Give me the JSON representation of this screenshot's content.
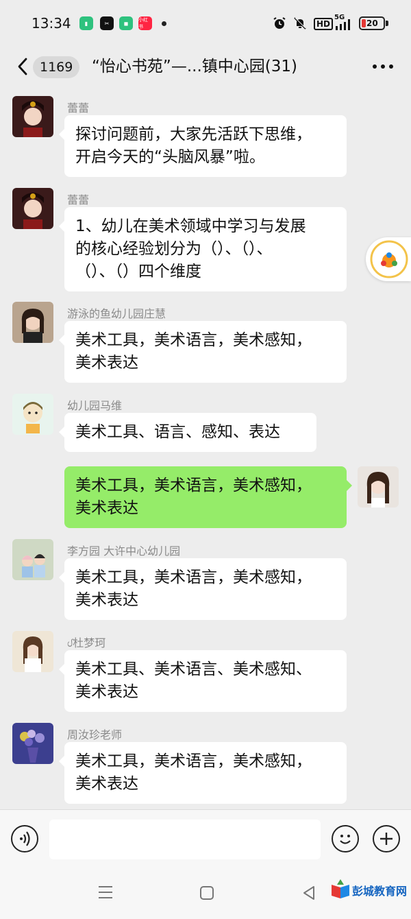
{
  "status_bar": {
    "time": "13:34",
    "app_icons": [
      "battery-app-icon",
      "capcut-icon",
      "wechat-icon",
      "xiaohongshu-icon"
    ],
    "xiaohongshu_label": "小红书",
    "network": "5G",
    "hd_label": "HD",
    "battery_level": "20",
    "icons": [
      "alarm-icon",
      "mute-icon",
      "hd-icon",
      "signal-icon",
      "battery-icon"
    ]
  },
  "header": {
    "unread_count": "1169",
    "title": "“怡心书苑”—...镇中心园(31)"
  },
  "messages": [
    {
      "sender": "蕾蕾",
      "lines": [
        "探讨问题前，大家先活跃下思维，",
        "开启今天的“头脑风暴”啦。"
      ],
      "mine": false
    },
    {
      "sender": "蕾蕾",
      "lines": [
        "1、幼儿在美术领域中学习与发展",
        "的核心经验划分为（）、（）、",
        "（）、（）四个维度"
      ],
      "mine": false
    },
    {
      "sender": "游泳的鱼幼儿园庄慧",
      "lines": [
        "美术工具，美术语言，美术感知，",
        "美术表达"
      ],
      "mine": false
    },
    {
      "sender": "幼儿园马维",
      "lines": [
        "美术工具、语言、感知、表达"
      ],
      "mine": false
    },
    {
      "sender": "",
      "lines": [
        "美术工具，美术语言，美术感知，",
        "美术表达"
      ],
      "mine": true
    },
    {
      "sender": "李方园 大许中心幼儿园",
      "lines": [
        "美术工具，美术语言，美术感知，",
        "美术表达"
      ],
      "mine": false
    },
    {
      "sender": "ᦔ杜梦珂",
      "lines": [
        "美术工具、美术语言、美术感知、",
        "美术表达"
      ],
      "mine": false
    },
    {
      "sender": "周汝珍老师",
      "lines": [
        "美术工具，美术语言，美术感知，",
        "美术表达"
      ],
      "mine": false
    }
  ],
  "input_bar": {
    "placeholder": "",
    "icons": [
      "voice-icon",
      "emoji-icon",
      "plus-icon"
    ]
  },
  "nav_bar": {
    "icons": [
      "menu-icon",
      "home-icon",
      "back-triangle-icon"
    ]
  },
  "watermark": {
    "text": "彭城教育网"
  },
  "colors": {
    "background": "#ededed",
    "my_bubble": "#95ec69",
    "other_bubble": "#ffffff",
    "sender_name": "#8a8a8a"
  }
}
